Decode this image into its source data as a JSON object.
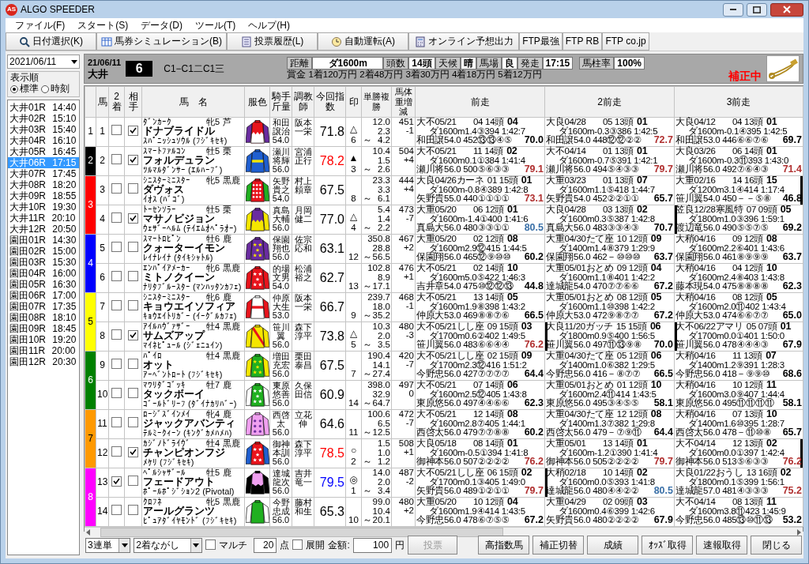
{
  "window": {
    "icon_label": "AS",
    "title": "ALGO SPEEDER"
  },
  "menu": [
    "ファイル(F)",
    "スタート(S)",
    "データ(D)",
    "ツール(T)",
    "ヘルプ(H)"
  ],
  "toolbar": [
    {
      "label": "日付選択(K)",
      "kind": "search"
    },
    {
      "label": "馬券シミュレーション(B)",
      "kind": "grid"
    },
    {
      "label": "投票履歴(L)",
      "kind": "list"
    },
    {
      "label": "自動運転(A)",
      "kind": "disc"
    },
    {
      "label": "オンライン予想出力",
      "kind": "calc"
    },
    {
      "label": "FTP最強",
      "kind": "none"
    },
    {
      "label": "FTP RB",
      "kind": "none"
    },
    {
      "label": "FTP co.jp",
      "kind": "none"
    }
  ],
  "sidebar": {
    "date": "2021/06/11",
    "order_label": "表示順",
    "order_options": [
      {
        "label": "標準",
        "selected": true
      },
      {
        "label": "時刻",
        "selected": false
      }
    ],
    "races": [
      {
        "label": "大井01R 14:40",
        "selected": false
      },
      {
        "label": "大井02R 15:10",
        "selected": false
      },
      {
        "label": "大井03R 15:40",
        "selected": false
      },
      {
        "label": "大井04R 16:10",
        "selected": false
      },
      {
        "label": "大井05R 16:45",
        "selected": false
      },
      {
        "label": "大井06R 17:15",
        "selected": true
      },
      {
        "label": "大井07R 17:45",
        "selected": false
      },
      {
        "label": "大井08R 18:20",
        "selected": false
      },
      {
        "label": "大井09R 18:55",
        "selected": false
      },
      {
        "label": "大井10R 19:30",
        "selected": false
      },
      {
        "label": "大井11R 20:10",
        "selected": false
      },
      {
        "label": "大井12R 20:50",
        "selected": false
      },
      {
        "label": "園田01R 14:30",
        "selected": false
      },
      {
        "label": "園田02R 15:00",
        "selected": false
      },
      {
        "label": "園田03R 15:30",
        "selected": false
      },
      {
        "label": "園田04R 16:00",
        "selected": false
      },
      {
        "label": "園田05R 16:30",
        "selected": false
      },
      {
        "label": "園田06R 17:00",
        "selected": false
      },
      {
        "label": "園田07R 17:35",
        "selected": false
      },
      {
        "label": "園田08R 18:10",
        "selected": false
      },
      {
        "label": "園田09R 18:45",
        "selected": false
      },
      {
        "label": "園田10R 19:20",
        "selected": false
      },
      {
        "label": "園田11R 20:00",
        "selected": false
      },
      {
        "label": "園田12R 20:30",
        "selected": false
      }
    ]
  },
  "race_header": {
    "date": "21/06/11",
    "venue": "大井",
    "number": "6",
    "class": "C1−C1二C1三",
    "conditions": [
      {
        "label": "距離",
        "value": "ダ1600m"
      },
      {
        "label": "頭数",
        "value": "14頭"
      },
      {
        "label": "天候",
        "value": "晴"
      },
      {
        "label": "馬場",
        "value": "良"
      },
      {
        "label": "発走",
        "value": "17:15"
      },
      {
        "label": "馬柱率",
        "value": "100%"
      }
    ],
    "prize": "賞金 1着120万円 2着48万円 3着30万円 4着18万円 5着12万円",
    "status": "補正中"
  },
  "table": {
    "columns": [
      "馬",
      "2着",
      "相手",
      "馬　名",
      "服色",
      "騎手斤量",
      "調教師",
      "今回指数",
      "印",
      "単勝複勝",
      "馬体重増減",
      "前走",
      "2前走",
      "3前走"
    ],
    "frames": [
      {
        "label": "1",
        "color": "#ffffff",
        "horses": [
          {
            "number": "1",
            "second": false,
            "partner": true,
            "sire": "ﾀﾞﾝｶｰｸ",
            "sex_age": "牝5",
            "coat": "芦",
            "name": "ドナブライドル",
            "dam": "ｽﾊﾟﾆｯｼｭｿｳﾙ (ﾌｼﾞｷｾｷ)",
            "jockey": "和田譲治",
            "weight": "54.0",
            "trainer": "阪本一栄",
            "index": "71.8",
            "color": "#000000",
            "mark": "△",
            "popularity": "6",
            "win": "12.0",
            "place_low": "2.3",
            "range_mark": "～",
            "place_high": "4.2",
            "body_weight": "451",
            "weight_diff": "-1",
            "past": [
              {
                "race": "大不05/21",
                "field": "04 14頭",
                "finish": "04",
                "course": "ダ1600m1.4③394 1:42:7",
                "jockey": "和田譲54.0 452⑬⑬④⑤",
                "index": "70.0",
                "color": "#000000",
                "left_bar": false,
                "right_bar": false
              },
              {
                "race": "大良04/28",
                "field": "05 13頭",
                "finish": "01",
                "course": "ダ1600m-0.3③386 1:42:5",
                "jockey": "和田譲54.0 448⑫⑫②②",
                "index": "72.7",
                "color": "#b03030",
                "left_bar": false,
                "right_bar": false
              },
              {
                "race": "大良04/12",
                "field": "04 13頭",
                "finish": "01",
                "course": "ダ1600m-0.1④395 1:42:5",
                "jockey": "和田譲53.0 446⑥⑥⑦⑥",
                "index": "69.7",
                "color": "#000000",
                "left_bar": false,
                "right_bar": false
              }
            ]
          }
        ]
      },
      {
        "label": "2",
        "color": "#000000",
        "horses": [
          {
            "number": "2",
            "second": false,
            "partner": true,
            "sire": "ｽﾏｰﾄﾌｧﾙｺﾝ",
            "sex_age": "牡5",
            "coat": "栗",
            "name": "フォルデュラン",
            "dam": "ﾂﾙﾏﾙﾀﾞﾝｻｰ (ｴﾙﾊｰﾌﾞ)",
            "jockey": "瀬川将輝",
            "weight": "56.0",
            "trainer": "宮浦正行",
            "index": "78.2",
            "color": "#ff0000",
            "mark": "▲",
            "popularity": "3",
            "win": "10.4",
            "place_low": "1.5",
            "range_mark": "～",
            "place_high": "2.6",
            "body_weight": "504",
            "weight_diff": "+4",
            "past": [
              {
                "race": "大不05/21",
                "field": "11 14頭",
                "finish": "02",
                "course": "ダ1600m0.1①384 1:41:4",
                "jockey": "瀬川将56.0 500⑤⑥③③",
                "index": "79.1",
                "color": "#b03030",
                "left_bar": false,
                "right_bar": false
              },
              {
                "race": "大不04/14",
                "field": "01 13頭",
                "finish": "01",
                "course": "ダ1600m-0.7⑤391 1:42:1",
                "jockey": "瀬川将56.0 494⑤④③③",
                "index": "79.7",
                "color": "#b03030",
                "left_bar": false,
                "right_bar": false
              },
              {
                "race": "大良03/26",
                "field": "06 14頭",
                "finish": "01",
                "course": "ダ1600m-0.3⑪393 1:43:0",
                "jockey": "瀬川将56.0 492⑦⑥④③",
                "index": "71.4",
                "color": "#b03030",
                "left_bar": false,
                "right_bar": false
              }
            ]
          }
        ]
      },
      {
        "label": "3",
        "color": "#ff0000",
        "horses": [
          {
            "number": "3",
            "second": false,
            "partner": false,
            "sire": "ｼﾆｽﾀｰﾐﾆｽﾀｰ",
            "sex_age": "牝5",
            "coat": "黒鹿",
            "name": "ダヴォス",
            "dam": "ｲｵｽ (ﾊﾞｺﾞ)",
            "jockey": "矢野貴之",
            "weight": "54.0",
            "trainer": "村上頼章",
            "index": "67.5",
            "color": "#000000",
            "popularity": "8",
            "win": "23.3",
            "place_low": "3.3",
            "range_mark": "～",
            "place_high": "6.1",
            "body_weight": "444",
            "weight_diff": "+4",
            "past": [
              {
                "race": "大良04/26カーネ",
                "field": "01 15頭",
                "finish": "01",
                "course": "ダ1600m-0.8④389 1:42:8",
                "jockey": "矢野貴55.0 440①①①①",
                "index": "73.1",
                "color": "#b03030",
                "left_bar": false,
                "right_bar": false
              },
              {
                "race": "大重03/23",
                "field": "01 13頭",
                "finish": "07",
                "course": "ダ1600m1.1⑤418 1:44:7",
                "jockey": "矢野貴54.0 452②②①①",
                "index": "65.7",
                "color": "#000000",
                "left_bar": false,
                "right_bar": false
              },
              {
                "race": "大重02/16",
                "field": "14 16頭",
                "finish": "15",
                "course": "ダ1200m3.1④414 1:17:4",
                "jockey": "笹川翼54.0 450－－⑤⑧",
                "index": "46.8",
                "color": "#000000",
                "left_bar": false,
                "right_bar": true
              }
            ]
          },
          {
            "number": "4",
            "second": false,
            "partner": true,
            "sire": "ﾄｰｾﾝｿﾗｰ",
            "sex_age": "牡5",
            "coat": "栗",
            "name": "マサノビジョン",
            "dam": "ｳｪｻﾞｰﾍﾙﾑ (ﾃｲｴﾑｵﾍﾟﾗｵｰ)",
            "jockey": "真島大輔",
            "weight": "56.0",
            "trainer": "月岡健二",
            "index": "77.0",
            "color": "#000000",
            "mark": "△",
            "popularity": "4",
            "win": "5.4",
            "place_low": "1.4",
            "range_mark": "～",
            "place_high": "2.2",
            "body_weight": "473",
            "weight_diff": "-7",
            "past": [
              {
                "race": "大重05/20",
                "field": "06 12頭",
                "finish": "01",
                "course": "ダ1600m-1.4①400 1:41:6",
                "jockey": "真島大56.0 480③③①①",
                "index": "80.5",
                "color": "#3a70a8",
                "left_bar": false,
                "right_bar": false
              },
              {
                "race": "大良04/28",
                "field": "03 13頭",
                "finish": "02",
                "course": "ダ1600m0.3⑤387 1:42:8",
                "jockey": "真島大56.0 483③③④③",
                "index": "70.7",
                "color": "#000000",
                "left_bar": false,
                "right_bar": false
              },
              {
                "race": "笠良12/28寒風特",
                "field": "07 09頭",
                "finish": "05",
                "course": "ダ1800m1.0③396 1:59:1",
                "jockey": "渡辺竜56.0 490⑤⑤⑦⑤",
                "index": "69.2",
                "color": "#000000",
                "left_bar": true,
                "right_bar": false
              }
            ]
          }
        ]
      },
      {
        "label": "4",
        "color": "#0000ff",
        "horses": [
          {
            "number": "5",
            "second": false,
            "partner": false,
            "sire": "ｽﾏｰﾄﾛﾋﾟﾝ",
            "sex_age": "牡6",
            "coat": "鹿",
            "name": "クォーターイモン",
            "dam": "ﾚｲﾅﾚｲﾅ (ﾀｲｷｼｬﾄﾙ)",
            "jockey": "保園翔也",
            "weight": "56.0",
            "trainer": "佐宗応和",
            "index": "63.1",
            "color": "#000000",
            "popularity": "12",
            "win": "350.8",
            "place_low": "28.8",
            "range_mark": "～",
            "place_high": "56.5",
            "body_weight": "467",
            "weight_diff": "+2",
            "past": [
              {
                "race": "大重05/20",
                "field": "02 12頭",
                "finish": "08",
                "course": "ダ1600m2.9⑫415 1:44:5",
                "jockey": "保園翔56.0 465⑫⑨⑩⑩",
                "index": "60.2",
                "color": "#000000",
                "left_bar": false,
                "right_bar": false
              },
              {
                "race": "大重04/30たて座",
                "field": "10 12頭",
                "finish": "09",
                "course": "ダ1400m1.4⑧379 1:29:9",
                "jockey": "保園翔56.0 462－⑩⑩⑩",
                "index": "63.7",
                "color": "#000000",
                "left_bar": false,
                "right_bar": false
              },
              {
                "race": "大稍04/16",
                "field": "09 12頭",
                "finish": "08",
                "course": "ダ1600m2.2⑥401 1:43:6",
                "jockey": "保園翔56.0 461⑧⑨⑨⑨",
                "index": "63.7",
                "color": "#000000",
                "left_bar": false,
                "right_bar": false
              }
            ]
          },
          {
            "number": "6",
            "second": false,
            "partner": false,
            "sire": "ｴﾝﾊﾟｲｱﾒｰｶｰ",
            "sex_age": "牝6",
            "coat": "黒鹿",
            "name": "ミトノクイーン",
            "dam": "ﾅﾘﾀﾌﾞﾙｰｽﾀｰ (ﾏﾝﾊｯﾀﾝｶﾌｪ)",
            "jockey": "的場文男",
            "weight": "54.0",
            "trainer": "松浦裕之",
            "index": "62.7",
            "color": "#000000",
            "popularity": "13",
            "win": "102.8",
            "place_low": "8.9",
            "range_mark": "～",
            "place_high": "17.1",
            "body_weight": "476",
            "weight_diff": "+1",
            "past": [
              {
                "race": "大不05/21",
                "field": "02 14頭",
                "finish": "10",
                "course": "ダ1600m5.0⑤422 1:46:3",
                "jockey": "吉井章54.0 475⑩⑫⑫⑬",
                "index": "44.8",
                "color": "#000000",
                "left_bar": false,
                "right_bar": false
              },
              {
                "race": "大重05/01おとめ",
                "field": "09 12頭",
                "finish": "04",
                "course": "ダ1600m1.1⑧401 1:42:2",
                "jockey": "達城龍54.0 470⑦⑦⑥⑥",
                "index": "67.2",
                "color": "#000000",
                "left_bar": false,
                "right_bar": false
              },
              {
                "race": "大稍04/16",
                "field": "04 12頭",
                "finish": "10",
                "course": "ダ1600m2.4⑧403 1:43:8",
                "jockey": "藤本現54.0 475⑧⑧⑧⑧",
                "index": "62.3",
                "color": "#000000",
                "left_bar": false,
                "right_bar": false
              }
            ]
          }
        ]
      },
      {
        "label": "5",
        "color": "#ffff00",
        "horses": [
          {
            "number": "7",
            "second": false,
            "partner": false,
            "sire": "ｼﾆｽﾀｰﾐﾆｽﾀｰ",
            "sex_age": "牝6",
            "coat": "鹿",
            "name": "キョウエイソフィア",
            "dam": "ｷｮｳｴｲﾄﾘｶﾞｰ (ｲｰｸﾞﾙｶﾌｪ)",
            "jockey": "仲原大生",
            "weight": "53.0",
            "trainer": "阪本一栄",
            "index": "66.7",
            "color": "#000000",
            "popularity": "9",
            "win": "239.7",
            "place_low": "18.0",
            "range_mark": "～",
            "place_high": "35.2",
            "body_weight": "468",
            "weight_diff": "-1",
            "past": [
              {
                "race": "大不05/21",
                "field": "13 14頭",
                "finish": "05",
                "course": "ダ1600m1.9⑧398 1:43:2",
                "jockey": "仲原大53.0 469⑧⑧⑦⑥",
                "index": "66.5",
                "color": "#000000",
                "left_bar": false,
                "right_bar": false
              },
              {
                "race": "大重05/01おとめ",
                "field": "08 12頭",
                "finish": "05",
                "course": "ダ1600m1.1⑩398 1:42:2",
                "jockey": "仲原大53.0 472⑨⑧⑦⑦",
                "index": "67.2",
                "color": "#000000",
                "left_bar": false,
                "right_bar": false
              },
              {
                "race": "大稍04/16",
                "field": "08 12頭",
                "finish": "05",
                "course": "ダ1600m2.0⑪402 1:43:4",
                "jockey": "仲原大53.0 474⑥⑥⑦⑦",
                "index": "65.0",
                "color": "#000000",
                "left_bar": false,
                "right_bar": false
              }
            ]
          },
          {
            "number": "8",
            "second": false,
            "partner": true,
            "sire": "ｱｲﾙﾊｳﾞｧｻﾞｰ",
            "sex_age": "牡4",
            "coat": "黒鹿",
            "name": "サムズアップ",
            "dam": "ﾏｲﾈﾋﾟｭｰﾙ (ｼﾞｪﾆｭｲﾝ)",
            "jockey": "笹川翼",
            "weight": "56.0",
            "trainer": "森下淳平",
            "index": "73.8",
            "color": "#000000",
            "mark": "△",
            "popularity": "5",
            "win": "10.3",
            "place_low": "2.0",
            "range_mark": "～",
            "place_high": "3.5",
            "body_weight": "480",
            "weight_diff": "-3",
            "past": [
              {
                "race": "大不05/21しし座",
                "field": "09 15頭",
                "finish": "03",
                "course": "ダ1700m0.6②402 1:49:5",
                "jockey": "笹川翼56.0 483⑥⑥④④",
                "index": "76.2",
                "color": "#b03030",
                "left_bar": false,
                "right_bar": false
              },
              {
                "race": "大良11/20ガッチ",
                "field": "15 15頭",
                "finish": "06",
                "course": "ダ1800m0.9⑤400 1:56:5",
                "jockey": "笹川翼56.0 497⑪⑬⑨⑧",
                "index": "70.0",
                "color": "#000000",
                "left_bar": true,
                "right_bar": false
              },
              {
                "race": "大不06/22アマリ",
                "field": "05 07頭",
                "finish": "01",
                "course": "ダ1700m0.0①401 1:50:0",
                "jockey": "笹川翼56.0 478④④④③",
                "index": "67.9",
                "color": "#000000",
                "left_bar": true,
                "right_bar": false
              }
            ]
          }
        ]
      },
      {
        "label": "6",
        "color": "#008000",
        "horses": [
          {
            "number": "9",
            "second": false,
            "partner": false,
            "sire": "ﾊﾟｲﾛ",
            "sex_age": "牡4",
            "coat": "黒鹿",
            "name": "オット",
            "dam": "ｱｰﾍﾞﾝﾄﾛｰﾄ (ﾌｼﾞｷｾｷ)",
            "jockey": "増田充宏",
            "weight": "56.0",
            "trainer": "栗田泰昌",
            "index": "67.5",
            "color": "#000000",
            "popularity": "7",
            "win": "190.4",
            "place_low": "14.1",
            "range_mark": "～",
            "place_high": "27.4",
            "body_weight": "420",
            "weight_diff": "-7",
            "past": [
              {
                "race": "大不05/21しし座",
                "field": "02 15頭",
                "finish": "09",
                "course": "ダ1700m2.3⑫416 1:51:2",
                "jockey": "今野忠56.0 427⑦⑦⑦⑦",
                "index": "64.4",
                "color": "#000000",
                "left_bar": false,
                "right_bar": false
              },
              {
                "race": "大重04/30たて座",
                "field": "05 12頭",
                "finish": "06",
                "course": "ダ1400m1.0⑥382 1:29:5",
                "jockey": "今野忠56.0 416－⑧⑦⑦",
                "index": "66.5",
                "color": "#000000",
                "left_bar": false,
                "right_bar": false
              },
              {
                "race": "大稍04/16",
                "field": "11 13頭",
                "finish": "07",
                "course": "ダ1400m1.2⑨391 1:28:3",
                "jockey": "今野忠56.0 418－⑨⑨⑩",
                "index": "68.6",
                "color": "#000000",
                "left_bar": false,
                "right_bar": false
              }
            ]
          },
          {
            "number": "10",
            "second": false,
            "partner": false,
            "sire": "ﾏﾜﾘﾀﾞｺﾞｯｷ",
            "sex_age": "牡7",
            "coat": "鹿",
            "name": "タックボーイ",
            "dam": "ｺﾞｰﾙﾄﾞﾘｰﾌ (ﾀﾞｲﾅｶﾘﾊﾞｰ)",
            "jockey": "東原悠善",
            "weight": "56.0",
            "trainer": "久保田信",
            "index": "60.9",
            "color": "#000000",
            "popularity": "14",
            "win": "398.0",
            "place_low": "32.9",
            "range_mark": "～",
            "place_high": "64.7",
            "body_weight": "497",
            "weight_diff": "0",
            "past": [
              {
                "race": "大不05/21",
                "field": "07 14頭",
                "finish": "06",
                "course": "ダ1600m2.5⑫405 1:43:8",
                "jockey": "東原悠56.0 497④④⑥⑥",
                "index": "62.3",
                "color": "#000000",
                "left_bar": false,
                "right_bar": false
              },
              {
                "race": "大重05/01おとめ",
                "field": "01 12頭",
                "finish": "10",
                "course": "ダ1600m2.4⑪414 1:43:5",
                "jockey": "東原悠56.0 495③④⑤⑤",
                "index": "58.1",
                "color": "#000000",
                "left_bar": false,
                "right_bar": false
              },
              {
                "race": "大稍04/16",
                "field": "10 12頭",
                "finish": "11",
                "course": "ダ1600m3.0⑨407 1:44:4",
                "jockey": "東原悠56.0 495⑪⑪⑪⑪",
                "index": "58.1",
                "color": "#000000",
                "left_bar": false,
                "right_bar": false
              }
            ]
          }
        ]
      },
      {
        "label": "7",
        "color": "#ff9900",
        "horses": [
          {
            "number": "11",
            "second": false,
            "partner": false,
            "sire": "ﾛｰｼﾞｽﾞｲﾝﾒｲ",
            "sex_age": "牝4",
            "coat": "鹿",
            "name": "ジャックアバンティ",
            "dam": "ﾃﾙﾐｰｸｨｰﾝ (ｷﾝｸﾞｶﾒﾊﾒﾊ)",
            "jockey": "西啓太",
            "weight": "56.0",
            "trainer": "立花伸",
            "index": "64.6",
            "color": "#000000",
            "popularity": "11",
            "win": "100.6",
            "place_low": "6.5",
            "range_mark": "～",
            "place_high": "12.5",
            "body_weight": "472",
            "weight_diff": "-7",
            "past": [
              {
                "race": "大不05/21",
                "field": "12 14頭",
                "finish": "08",
                "course": "ダ1600m2.8⑦405 1:44:1",
                "jockey": "西啓太56.0 479⑦⑦⑧⑧",
                "index": "60.2",
                "color": "#000000",
                "left_bar": false,
                "right_bar": false
              },
              {
                "race": "大重04/30たて座",
                "field": "12 12頭",
                "finish": "08",
                "course": "ダ1400m1.3⑦382 1:29:8",
                "jockey": "西啓太56.0 479－⑦⑨⑪",
                "index": "64.4",
                "color": "#000000",
                "left_bar": false,
                "right_bar": false
              },
              {
                "race": "大稍04/16",
                "field": "07 13頭",
                "finish": "10",
                "course": "ダ1400m1.6⑩395 1:28:7",
                "jockey": "西啓太56.0 478－⑪⑩⑧",
                "index": "65.7",
                "color": "#000000",
                "left_bar": false,
                "right_bar": false
              }
            ]
          },
          {
            "number": "12",
            "second": false,
            "partner": true,
            "sire": "ｶｼﾞﾉﾄﾞﾗｲｳﾞ",
            "sex_age": "牡4",
            "coat": "黒鹿",
            "name": "チャンピオンフジ",
            "dam": "ﾒｹﾘ (ﾌｼﾞｷｾｷ)",
            "jockey": "御神本訓",
            "weight": "56.0",
            "trainer": "森下淳平",
            "index": "78.5",
            "color": "#ff0000",
            "mark": "○",
            "popularity": "2",
            "win": "1.5",
            "place_low": "1.0",
            "range_mark": "～",
            "place_high": "1.2",
            "body_weight": "508",
            "weight_diff": "+1",
            "past": [
              {
                "race": "大良05/18",
                "field": "08 14頭",
                "finish": "01",
                "course": "ダ1600m-0.5①394 1:41:8",
                "jockey": "御神本56.0 507②②②②",
                "index": "76.2",
                "color": "#b03030",
                "left_bar": false,
                "right_bar": false
              },
              {
                "race": "大重05/01",
                "field": "13 14頭",
                "finish": "01",
                "course": "ダ1600m-1.2①390 1:41:4",
                "jockey": "御神本56.0 505②②②②",
                "index": "79.7",
                "color": "#b03030",
                "left_bar": false,
                "right_bar": false
              },
              {
                "race": "大不04/14",
                "field": "12 13頭",
                "finish": "02",
                "course": "ダ1600m0.0①397 1:42:4",
                "jockey": "御神本56.0 513⑤⑥③③",
                "index": "76.2",
                "color": "#b03030",
                "left_bar": false,
                "right_bar": true
              }
            ]
          }
        ]
      },
      {
        "label": "8",
        "color": "#ff00ff",
        "horses": [
          {
            "number": "13",
            "second": true,
            "partner": false,
            "sire": "ﾍﾟﾙｼｬｻﾞｰﾙ",
            "sex_age": "牡5",
            "coat": "鹿",
            "name": "フェードアウト",
            "dam": "ﾎﾟｰﾙﾎﾟｼﾞｼｮﾝ2 (Pivotal)",
            "jockey": "達城龍次",
            "weight": "56.0",
            "trainer": "吉井竜一",
            "index": "79.5",
            "color": "#0000ff",
            "mark": "◎",
            "popularity": "1",
            "win": "14.0",
            "place_low": "2.0",
            "range_mark": "～",
            "place_high": "3.4",
            "body_weight": "487",
            "weight_diff": "-2",
            "past": [
              {
                "race": "大不05/21しし座",
                "field": "06 15頭",
                "finish": "02",
                "course": "ダ1700m0.1③405 1:49:0",
                "jockey": "矢野貴56.0 489①②①①",
                "index": "79.7",
                "color": "#b03030",
                "left_bar": false,
                "right_bar": false
              },
              {
                "race": "大稍02/18",
                "field": "10 14頭",
                "finish": "02",
                "course": "ダ1600m0.0⑤393 1:41:8",
                "jockey": "達城龍56.0 480④④②②",
                "index": "80.5",
                "color": "#3a70a8",
                "left_bar": true,
                "right_bar": false
              },
              {
                "race": "大良01/22おうし",
                "field": "13 16頭",
                "finish": "02",
                "course": "ダ1800m0.1⑤399 1:56:1",
                "jockey": "達城龍57.0 481④③③③",
                "index": "75.2",
                "color": "#b03030",
                "left_bar": false,
                "right_bar": false
              }
            ]
          },
          {
            "number": "14",
            "second": false,
            "partner": false,
            "sire": "ｸﾛﾌﾈ",
            "sex_age": "牝5",
            "coat": "黒鹿",
            "name": "アールグランツ",
            "dam": "ﾋﾟｭｱﾀﾞｲﾔﾓﾝﾄﾞ (ﾌｼﾞｷｾｷ)",
            "jockey": "今野忠成",
            "weight": "56.0",
            "trainer": "藤村和生",
            "index": "65.3",
            "color": "#000000",
            "popularity": "10",
            "win": "99.0",
            "place_low": "10.4",
            "range_mark": "～",
            "place_high": "20.1",
            "body_weight": "480",
            "weight_diff": "+2",
            "past": [
              {
                "race": "大重05/20",
                "field": "10 12頭",
                "finish": "04",
                "course": "ダ1600m1.9④414 1:43:5",
                "jockey": "今野忠56.0 478⑥⑦⑤⑤",
                "index": "67.2",
                "color": "#000000",
                "left_bar": false,
                "right_bar": false
              },
              {
                "race": "大重04/29",
                "field": "02 09頭",
                "finish": "03",
                "course": "ダ1600m0.4⑥399 1:42:6",
                "jockey": "矢野貴56.0 480②②②②",
                "index": "67.9",
                "color": "#000000",
                "left_bar": false,
                "right_bar": false
              },
              {
                "race": "大不04/14",
                "field": "08 13頭",
                "finish": "11",
                "course": "ダ1600m3.8⑪423 1:45:9",
                "jockey": "今野忠56.0 485⑬⑩⑪⑬",
                "index": "53.2",
                "color": "#000000",
                "left_bar": false,
                "right_bar": false
              }
            ]
          }
        ]
      }
    ]
  },
  "bottom_bar": {
    "bet_type": "3連単",
    "bet_method": "2着ながし",
    "multi": {
      "label": "マルチ",
      "checked": false
    },
    "points": "20",
    "points_unit": "点",
    "expand": {
      "label": "展開",
      "checked": false
    },
    "amount_label": "金額:",
    "amount": "100",
    "amount_unit": "円",
    "buttons": [
      {
        "label": "投票",
        "disabled": true
      },
      {
        "label": "高指数馬",
        "disabled": false
      },
      {
        "label": "補正切替",
        "disabled": false
      },
      {
        "label": "成績",
        "disabled": false
      },
      {
        "label": "ｵｯｽﾞ取得",
        "disabled": false
      },
      {
        "label": "速報取得",
        "disabled": false
      },
      {
        "label": "閉じる",
        "disabled": false
      }
    ]
  }
}
